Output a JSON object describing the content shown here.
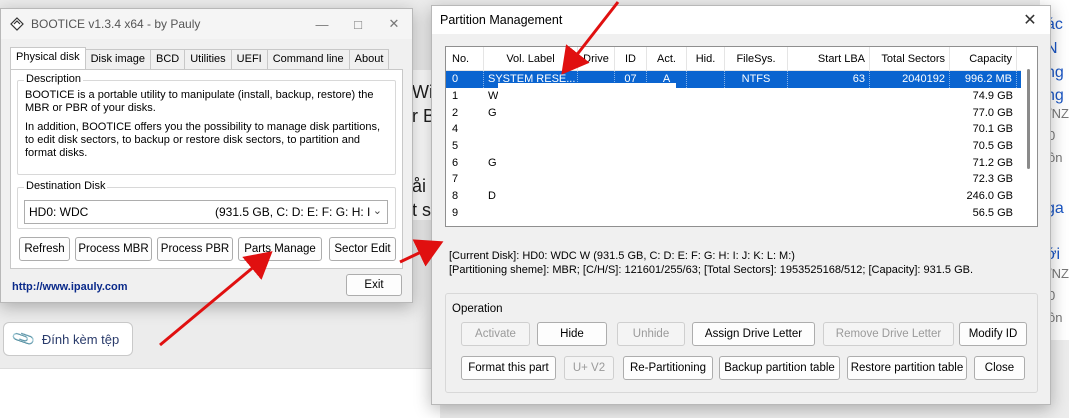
{
  "background": {
    "words": [
      "Wir",
      "r B",
      "åi d",
      "t s"
    ],
    "right_items": [
      "ác",
      "N",
      "ng",
      "ng",
      "/NZ",
      "ôn",
      "ga",
      "ới",
      "/NZ",
      "ôn"
    ],
    "right_counts": [
      "0",
      "0"
    ],
    "attach_label": "Đính kèm tệp",
    "attach_icon": "paperclip-icon"
  },
  "bootice": {
    "title": "BOOTICE v1.3.4 x64 - by Pauly",
    "tabs": [
      "Physical disk",
      "Disk image",
      "BCD",
      "Utilities",
      "UEFI",
      "Command line",
      "About"
    ],
    "description_label": "Description",
    "description_p1": "BOOTICE is a portable utility to manipulate (install, backup, restore) the MBR or PBR of your disks.",
    "description_p2": "In addition, BOOTICE offers you the possibility to manage disk partitions, to edit disk sectors, to backup or restore disk sectors, to partition and format disks.",
    "destination_label": "Destination Disk",
    "destination_device": "HD0: WDC",
    "destination_info": "(931.5 GB, C: D: E: F: G: H: I",
    "buttons": {
      "refresh": "Refresh",
      "process_mbr": "Process MBR",
      "process_pbr": "Process PBR",
      "parts_manage": "Parts Manage",
      "sector_edit": "Sector Edit",
      "exit": "Exit"
    },
    "link": "http://www.ipauly.com"
  },
  "partition_mgmt": {
    "title": "Partition Management",
    "columns": [
      "No.",
      "Vol. Label",
      "Drive",
      "ID",
      "Act.",
      "Hid.",
      "FileSys.",
      "Start LBA",
      "Total Sectors",
      "Capacity"
    ],
    "rows": [
      {
        "no": "0",
        "vol": "SYSTEM RESE...",
        "drive": "",
        "id": "07",
        "act": "A",
        "hid": "",
        "fs": "NTFS",
        "start": "63",
        "total": "2040192",
        "cap": "996.2 MB"
      },
      {
        "no": "1",
        "vol": "W",
        "drive": "",
        "id": "",
        "act": "",
        "hid": "",
        "fs": "",
        "start": "",
        "total": "",
        "cap": "74.9 GB"
      },
      {
        "no": "2",
        "vol": "G",
        "drive": "",
        "id": "",
        "act": "",
        "hid": "",
        "fs": "",
        "start": "",
        "total": "",
        "cap": "77.0 GB"
      },
      {
        "no": "4",
        "vol": "",
        "drive": "",
        "id": "",
        "act": "",
        "hid": "",
        "fs": "",
        "start": "",
        "total": "",
        "cap": "70.1 GB"
      },
      {
        "no": "5",
        "vol": "",
        "drive": "",
        "id": "",
        "act": "",
        "hid": "",
        "fs": "",
        "start": "",
        "total": "",
        "cap": "70.5 GB"
      },
      {
        "no": "6",
        "vol": "G",
        "drive": "",
        "id": "",
        "act": "",
        "hid": "",
        "fs": "",
        "start": "",
        "total": "",
        "cap": "71.2 GB"
      },
      {
        "no": "7",
        "vol": "",
        "drive": "",
        "id": "",
        "act": "",
        "hid": "",
        "fs": "",
        "start": "",
        "total": "",
        "cap": "72.3 GB"
      },
      {
        "no": "8",
        "vol": "D",
        "drive": "",
        "id": "",
        "act": "",
        "hid": "",
        "fs": "",
        "start": "",
        "total": "",
        "cap": "246.0 GB"
      },
      {
        "no": "9",
        "vol": "",
        "drive": "",
        "id": "",
        "act": "",
        "hid": "",
        "fs": "",
        "start": "",
        "total": "",
        "cap": "56.5 GB"
      }
    ],
    "current_disk": "[Current Disk]:   HD0: WDC W              (931.5 GB, C: D: E: F: G: H: I: J: K: L: M:)",
    "partitioning_scheme": "[Partitioning sheme]:    MBR;      [C/H/S]: 121601/255/63; [Total Sectors]: 1953525168/512; [Capacity]: 931.5 GB.",
    "operation_label": "Operation",
    "buttons": {
      "activate": "Activate",
      "hide": "Hide",
      "unhide": "Unhide",
      "assign_drive_letter": "Assign Drive Letter",
      "remove_drive_letter": "Remove Drive Letter",
      "modify_id": "Modify ID",
      "format_this_part": "Format this part",
      "uv2": "U+ V2",
      "repartitioning": "Re-Partitioning",
      "backup_table": "Backup partition table",
      "restore_table": "Restore partition table",
      "close": "Close"
    }
  },
  "colors": {
    "selection": "#0a64d0",
    "arrow": "#e01010",
    "link": "#0a2a8a"
  }
}
